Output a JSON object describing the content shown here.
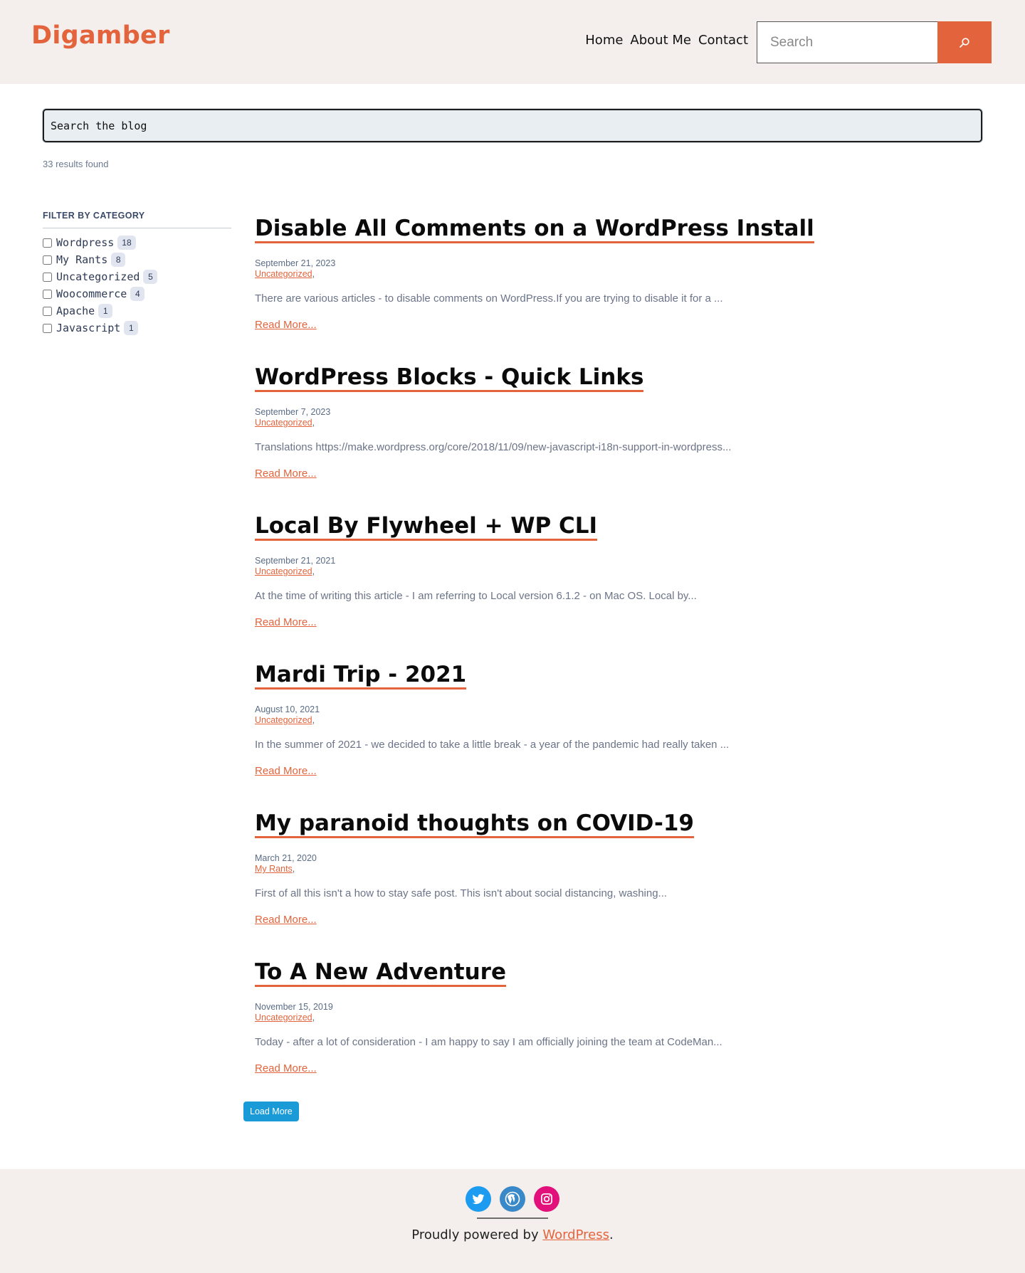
{
  "header": {
    "site_title": "Digamber",
    "nav": [
      {
        "label": "Home"
      },
      {
        "label": "About Me"
      },
      {
        "label": "Contact"
      }
    ],
    "search_placeholder": "Search"
  },
  "blog_search": {
    "placeholder": "Search the blog",
    "results_text": "33 results found"
  },
  "sidebar": {
    "title": "FILTER BY CATEGORY",
    "categories": [
      {
        "label": "Wordpress",
        "count": "18"
      },
      {
        "label": "My Rants",
        "count": "8"
      },
      {
        "label": "Uncategorized",
        "count": "5"
      },
      {
        "label": "Woocommerce",
        "count": "4"
      },
      {
        "label": "Apache",
        "count": "1"
      },
      {
        "label": "Javascript",
        "count": "1"
      }
    ]
  },
  "posts": [
    {
      "title": "Disable All Comments on a WordPress Install",
      "date": "September 21, 2023",
      "category": "Uncategorized",
      "excerpt": "There are various articles - to disable comments on WordPress.If you are trying to disable it for a ...",
      "read_more": "Read More..."
    },
    {
      "title": "WordPress Blocks - Quick Links",
      "date": "September 7, 2023",
      "category": "Uncategorized",
      "excerpt": "Translations https://make.wordpress.org/core/2018/11/09/new-javascript-i18n-support-in-wordpress...",
      "read_more": "Read More..."
    },
    {
      "title": "Local By Flywheel + WP CLI",
      "date": "September 21, 2021",
      "category": "Uncategorized",
      "excerpt": "At the time of writing this article - I am referring to Local version 6.1.2 - on Mac OS. Local by...",
      "read_more": "Read More..."
    },
    {
      "title": "Mardi Trip - 2021",
      "date": "August 10, 2021",
      "category": "Uncategorized",
      "excerpt": "In the summer of 2021 - we decided to take a little break - a year of the pandemic had really taken ...",
      "read_more": "Read More..."
    },
    {
      "title": "My paranoid thoughts on COVID-19",
      "date": "March 21, 2020",
      "category": "My Rants",
      "excerpt": "First of all this isn't a how to stay safe post. This isn't about social distancing, washing...",
      "read_more": "Read More..."
    },
    {
      "title": "To A New Adventure",
      "date": "November 15, 2019",
      "category": "Uncategorized",
      "excerpt": "Today - after a lot of consideration - I am happy to say I am officially joining the team at CodeMan...",
      "read_more": "Read More..."
    }
  ],
  "category_suffix": ",",
  "load_more": "Load More",
  "footer": {
    "social": [
      {
        "icon": "twitter-icon",
        "color": "#1d9bf0"
      },
      {
        "icon": "wordpress-icon",
        "color": "#3988c7"
      },
      {
        "icon": "instagram-icon",
        "color": "#e1107a"
      }
    ],
    "powered_prefix": "Proudly powered by ",
    "powered_link": "WordPress",
    "powered_suffix": "."
  },
  "colors": {
    "accent": "#e3643c",
    "header_bg": "#f4efec",
    "load_more_bg": "#1a9ad6"
  }
}
